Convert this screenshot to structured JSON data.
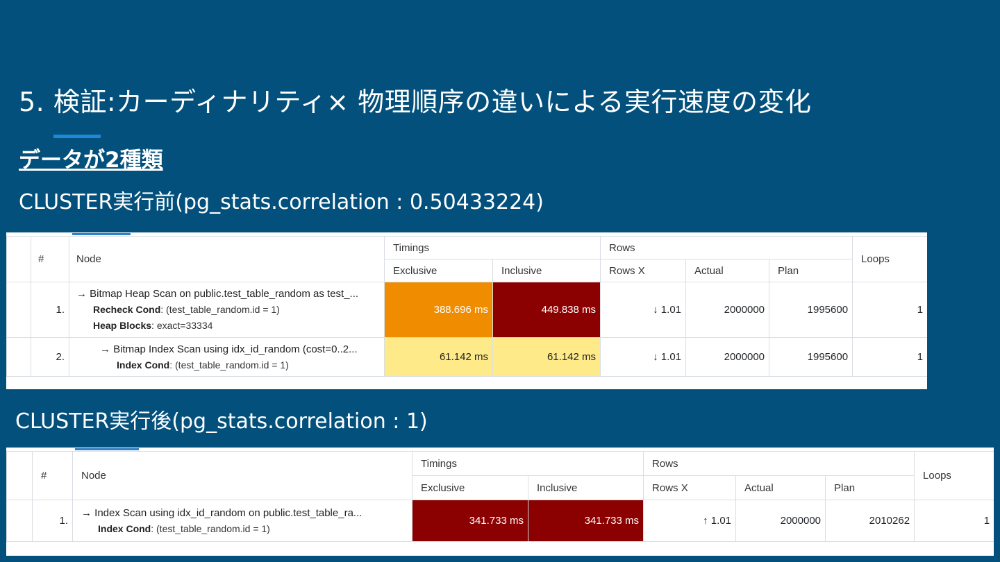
{
  "slide": {
    "title": "5.  検証:カーディナリティ× 物理順序の違いによる実行速度の変化",
    "subtitle": "データが2種類",
    "caption_before": "CLUSTER実行前(pg_stats.correlation : 0.50433224)",
    "caption_after": "CLUSTER実行後(pg_stats.correlation : 1)"
  },
  "headers": {
    "index": "#",
    "node": "Node",
    "timings": "Timings",
    "exclusive": "Exclusive",
    "inclusive": "Inclusive",
    "rows": "Rows",
    "rows_x": "Rows X",
    "actual": "Actual",
    "plan": "Plan",
    "loops": "Loops"
  },
  "colors": {
    "background": "#02507b",
    "orange": "#ef8c00",
    "dark_red": "#8b0000",
    "yellow": "#ffea8a"
  },
  "before": {
    "rows": [
      {
        "index": "1.",
        "node": "→ Bitmap Heap Scan on public.test_table_random as test_...",
        "detail1_key": "Recheck Cond",
        "detail1_val": ": (test_table_random.id = 1)",
        "detail2_key": "Heap Blocks",
        "detail2_val": ": exact=33334",
        "exclusive": "388.696 ms",
        "inclusive": "449.838 ms",
        "rows_x": "↓ 1.01",
        "actual": "2000000",
        "plan": "1995600",
        "loops": "1"
      },
      {
        "index": "2.",
        "node": "→ Bitmap Index Scan using idx_id_random (cost=0..2...",
        "detail1_key": "Index Cond",
        "detail1_val": ": (test_table_random.id = 1)",
        "exclusive": "61.142 ms",
        "inclusive": "61.142 ms",
        "rows_x": "↓ 1.01",
        "actual": "2000000",
        "plan": "1995600",
        "loops": "1"
      }
    ]
  },
  "after": {
    "rows": [
      {
        "index": "1.",
        "node": "→ Index Scan using idx_id_random on public.test_table_ra...",
        "detail1_key": "Index Cond",
        "detail1_val": ": (test_table_random.id = 1)",
        "exclusive": "341.733 ms",
        "inclusive": "341.733 ms",
        "rows_x": "↑ 1.01",
        "actual": "2000000",
        "plan": "2010262",
        "loops": "1"
      }
    ]
  }
}
